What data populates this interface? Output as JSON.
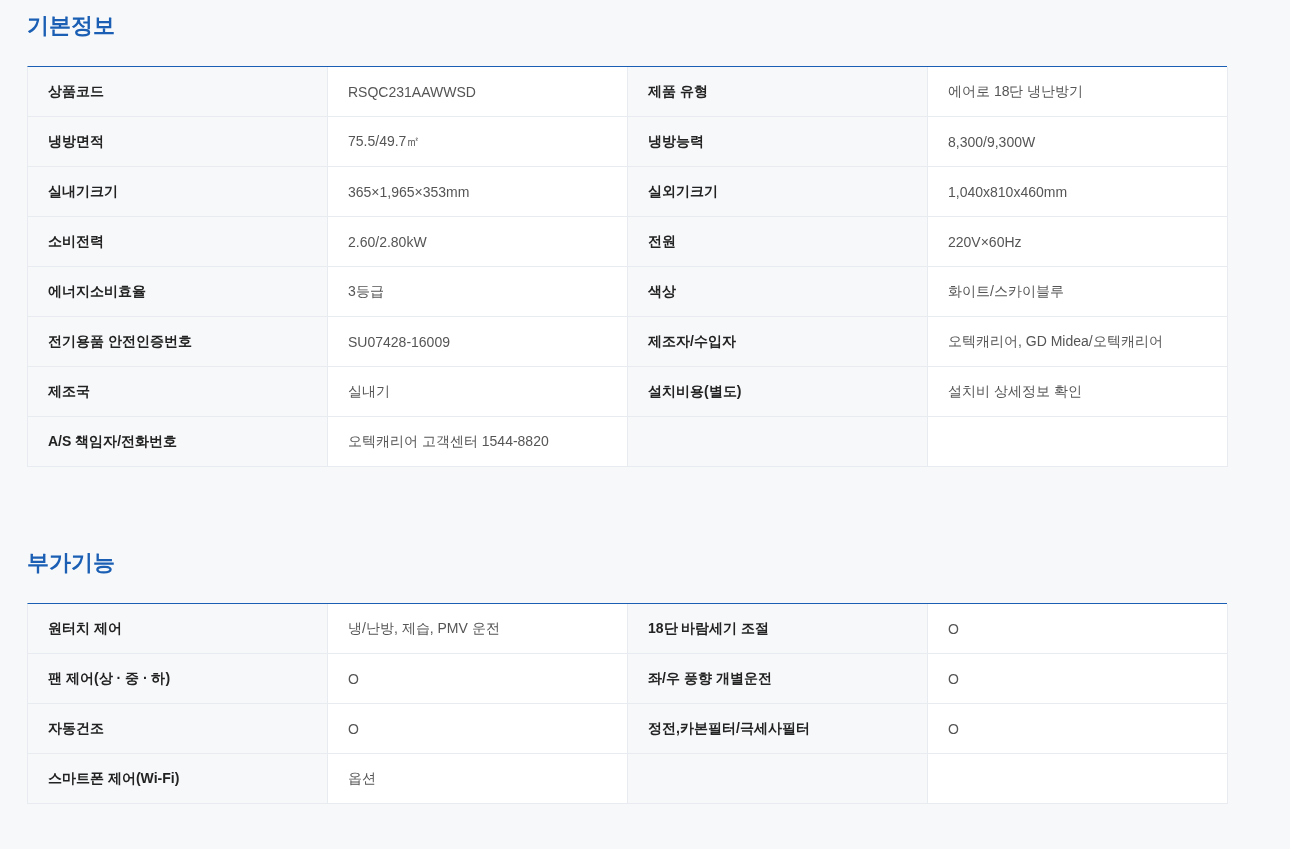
{
  "sections": [
    {
      "title": "기본정보",
      "rows": [
        {
          "items": [
            {
              "label": "상품코드",
              "value": "RSQC231AAWWSD"
            },
            {
              "label": "제품 유형",
              "value": "에어로 18단 냉난방기"
            }
          ]
        },
        {
          "items": [
            {
              "label": "냉방면적",
              "value": "75.5/49.7㎡"
            },
            {
              "label": "냉방능력",
              "value": "8,300/9,300W"
            }
          ]
        },
        {
          "items": [
            {
              "label": "실내기크기",
              "value": "365×1,965×353mm"
            },
            {
              "label": "실외기크기",
              "value": "1,040x810x460mm"
            }
          ]
        },
        {
          "items": [
            {
              "label": "소비전력",
              "value": "2.60/2.80kW"
            },
            {
              "label": "전원",
              "value": "220V×60Hz"
            }
          ]
        },
        {
          "items": [
            {
              "label": "에너지소비효율",
              "value": "3등급"
            },
            {
              "label": "색상",
              "value": "화이트/스카이블루"
            }
          ]
        },
        {
          "items": [
            {
              "label": "전기용품 안전인증번호",
              "value": "SU07428-16009"
            },
            {
              "label": "제조자/수입자",
              "value": "오텍캐리어, GD Midea/오텍캐리어"
            }
          ]
        },
        {
          "items": [
            {
              "label": "제조국",
              "value": "실내기"
            },
            {
              "label": "설치비용(별도)",
              "value": "설치비 상세정보 확인"
            }
          ]
        },
        {
          "items": [
            {
              "label": "A/S 책임자/전화번호",
              "value": "오텍캐리어 고객센터 1544-8820"
            }
          ]
        }
      ]
    },
    {
      "title": "부가기능",
      "rows": [
        {
          "items": [
            {
              "label": "원터치 제어",
              "value": "냉/난방, 제습, PMV 운전"
            },
            {
              "label": "18단 바람세기 조절",
              "value": "O"
            }
          ]
        },
        {
          "items": [
            {
              "label": "팬 제어(상 · 중 · 하)",
              "value": "O"
            },
            {
              "label": "좌/우 풍향 개별운전",
              "value": "O"
            }
          ]
        },
        {
          "items": [
            {
              "label": "자동건조",
              "value": "O"
            },
            {
              "label": "정전,카본필터/극세사필터",
              "value": "O"
            }
          ]
        },
        {
          "items": [
            {
              "label": "스마트폰 제어(Wi-Fi)",
              "value": "옵션"
            }
          ]
        }
      ]
    }
  ]
}
